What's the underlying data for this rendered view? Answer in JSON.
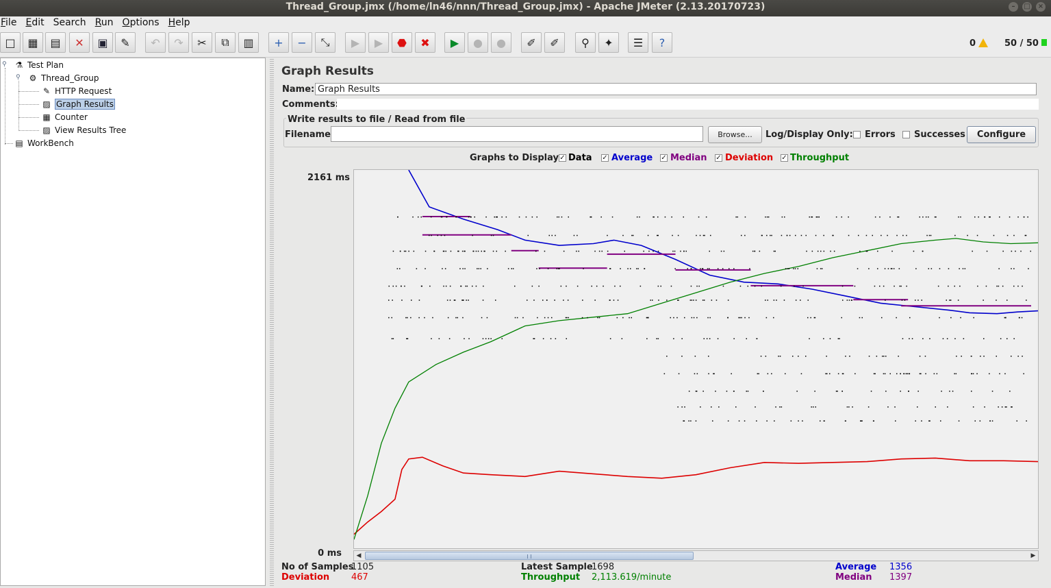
{
  "window": {
    "title": "Thread_Group.jmx (/home/ln46/nnn/Thread_Group.jmx) - Apache JMeter (2.13.20170723)"
  },
  "menu": [
    {
      "underline": "F",
      "rest": "ile"
    },
    {
      "underline": "E",
      "rest": "dit"
    },
    {
      "underline": "",
      "rest": "Search"
    },
    {
      "underline": "R",
      "rest": "un"
    },
    {
      "underline": "O",
      "rest": "ptions"
    },
    {
      "underline": "H",
      "rest": "elp"
    }
  ],
  "toolbar": {
    "buttons": [
      {
        "name": "new-icon",
        "glyph": "□",
        "disabled": false
      },
      {
        "name": "templates-icon",
        "glyph": "▦",
        "disabled": false
      },
      {
        "name": "open-icon",
        "glyph": "▤",
        "disabled": false
      },
      {
        "name": "close-icon",
        "glyph": "✕",
        "disabled": false
      },
      {
        "name": "save-icon",
        "glyph": "▣",
        "disabled": false
      },
      {
        "name": "save-as-icon",
        "glyph": "✎",
        "disabled": false
      },
      {
        "name": "undo-icon",
        "glyph": "↶",
        "disabled": true
      },
      {
        "name": "redo-icon",
        "glyph": "↷",
        "disabled": true
      },
      {
        "name": "cut-icon",
        "glyph": "✂",
        "disabled": false
      },
      {
        "name": "copy-icon",
        "glyph": "⧉",
        "disabled": false
      },
      {
        "name": "paste-icon",
        "glyph": "▥",
        "disabled": false
      },
      {
        "name": "expand-icon",
        "glyph": "+",
        "disabled": false
      },
      {
        "name": "collapse-icon",
        "glyph": "−",
        "disabled": false
      },
      {
        "name": "toggle-icon",
        "glyph": "⤡",
        "disabled": false
      },
      {
        "name": "start-icon",
        "glyph": "▶",
        "disabled": true
      },
      {
        "name": "start-no-pause-icon",
        "glyph": "▶",
        "disabled": true
      },
      {
        "name": "stop-icon",
        "glyph": "⬣",
        "disabled": false
      },
      {
        "name": "shutdown-icon",
        "glyph": "✖",
        "disabled": false
      },
      {
        "name": "remote-start-icon",
        "glyph": "▶",
        "disabled": false
      },
      {
        "name": "remote-stop-icon",
        "glyph": "●",
        "disabled": true
      },
      {
        "name": "remote-exit-icon",
        "glyph": "●",
        "disabled": true
      },
      {
        "name": "clear-icon",
        "glyph": "✐",
        "disabled": false
      },
      {
        "name": "clear-all-icon",
        "glyph": "✐",
        "disabled": false
      },
      {
        "name": "search-icon",
        "glyph": "⚲",
        "disabled": false
      },
      {
        "name": "reset-search-icon",
        "glyph": "✦",
        "disabled": false
      },
      {
        "name": "function-helper-icon",
        "glyph": "☰",
        "disabled": false
      },
      {
        "name": "help-icon",
        "glyph": "?",
        "disabled": false
      }
    ],
    "error_count": "0",
    "threads": "50 / 50"
  },
  "tree": {
    "items": [
      {
        "label": "Test Plan",
        "icon": "test-plan-icon",
        "glyph": "⚗"
      },
      {
        "label": "Thread_Group",
        "icon": "thread-group-icon",
        "glyph": "⚙"
      },
      {
        "label": "HTTP Request",
        "icon": "http-request-icon",
        "glyph": "✎"
      },
      {
        "label": "Graph Results",
        "icon": "graph-results-icon",
        "glyph": "▨"
      },
      {
        "label": "Counter",
        "icon": "counter-icon",
        "glyph": "▦"
      },
      {
        "label": "View Results Tree",
        "icon": "view-results-tree-icon",
        "glyph": "▨"
      },
      {
        "label": "WorkBench",
        "icon": "workbench-icon",
        "glyph": "▤"
      }
    ]
  },
  "panel": {
    "title": "Graph Results",
    "name_label": "Name:",
    "name_value": "Graph Results",
    "comments_label": "Comments:",
    "file_section_title": "Write results to file / Read from file",
    "filename_label": "Filename",
    "filename_value": "",
    "browse_label": "Browse...",
    "log_display_label": "Log/Display Only:",
    "errors_label": "Errors",
    "successes_label": "Successes",
    "configure_label": "Configure",
    "graphs_to_display_label": "Graphs to Display",
    "toggles": [
      {
        "label": "Data",
        "color": "#000000",
        "checked": true
      },
      {
        "label": "Average",
        "color": "#0000cc",
        "checked": true
      },
      {
        "label": "Median",
        "color": "#800080",
        "checked": true
      },
      {
        "label": "Deviation",
        "color": "#dd0000",
        "checked": true
      },
      {
        "label": "Throughput",
        "color": "#008000",
        "checked": true
      }
    ],
    "y_max_label": "2161  ms",
    "y_min_label": "0  ms"
  },
  "chart_data": {
    "type": "line",
    "y_unit": "ms",
    "ylim": [
      0,
      2161
    ],
    "series": [
      {
        "name": "Average",
        "color": "#0000cc",
        "samples": [
          [
            0.08,
            2161
          ],
          [
            0.11,
            1950
          ],
          [
            0.16,
            1880
          ],
          [
            0.21,
            1820
          ],
          [
            0.25,
            1760
          ],
          [
            0.3,
            1730
          ],
          [
            0.35,
            1740
          ],
          [
            0.38,
            1760
          ],
          [
            0.42,
            1730
          ],
          [
            0.47,
            1650
          ],
          [
            0.52,
            1560
          ],
          [
            0.57,
            1520
          ],
          [
            0.62,
            1510
          ],
          [
            0.67,
            1480
          ],
          [
            0.72,
            1440
          ],
          [
            0.77,
            1400
          ],
          [
            0.82,
            1380
          ],
          [
            0.87,
            1360
          ],
          [
            0.9,
            1345
          ],
          [
            0.94,
            1340
          ],
          [
            0.97,
            1350
          ],
          [
            1.0,
            1356
          ]
        ]
      },
      {
        "name": "Deviation",
        "color": "#dd0000",
        "samples": [
          [
            0.0,
            80
          ],
          [
            0.02,
            150
          ],
          [
            0.04,
            210
          ],
          [
            0.06,
            280
          ],
          [
            0.07,
            450
          ],
          [
            0.08,
            510
          ],
          [
            0.1,
            520
          ],
          [
            0.13,
            470
          ],
          [
            0.16,
            430
          ],
          [
            0.2,
            420
          ],
          [
            0.25,
            410
          ],
          [
            0.3,
            440
          ],
          [
            0.35,
            425
          ],
          [
            0.4,
            410
          ],
          [
            0.45,
            400
          ],
          [
            0.5,
            420
          ],
          [
            0.55,
            460
          ],
          [
            0.6,
            490
          ],
          [
            0.65,
            485
          ],
          [
            0.7,
            490
          ],
          [
            0.75,
            495
          ],
          [
            0.8,
            510
          ],
          [
            0.85,
            515
          ],
          [
            0.9,
            500
          ],
          [
            0.95,
            500
          ],
          [
            1.0,
            495
          ]
        ]
      },
      {
        "name": "Throughput",
        "color": "#008000",
        "samples": [
          [
            0.0,
            50
          ],
          [
            0.02,
            300
          ],
          [
            0.04,
            600
          ],
          [
            0.06,
            800
          ],
          [
            0.08,
            950
          ],
          [
            0.12,
            1050
          ],
          [
            0.16,
            1120
          ],
          [
            0.2,
            1180
          ],
          [
            0.25,
            1270
          ],
          [
            0.3,
            1300
          ],
          [
            0.35,
            1320
          ],
          [
            0.4,
            1340
          ],
          [
            0.45,
            1400
          ],
          [
            0.5,
            1460
          ],
          [
            0.55,
            1520
          ],
          [
            0.6,
            1570
          ],
          [
            0.65,
            1610
          ],
          [
            0.7,
            1660
          ],
          [
            0.75,
            1700
          ],
          [
            0.8,
            1740
          ],
          [
            0.85,
            1760
          ],
          [
            0.88,
            1770
          ],
          [
            0.92,
            1750
          ],
          [
            0.96,
            1740
          ],
          [
            1.0,
            1745
          ]
        ]
      },
      {
        "name": "Median",
        "color": "#800080",
        "segments": [
          [
            0.1,
            0.17,
            1895
          ],
          [
            0.1,
            0.23,
            1790
          ],
          [
            0.23,
            0.27,
            1700
          ],
          [
            0.27,
            0.37,
            1600
          ],
          [
            0.37,
            0.47,
            1680
          ],
          [
            0.47,
            0.58,
            1590
          ],
          [
            0.58,
            0.73,
            1500
          ],
          [
            0.73,
            0.81,
            1420
          ],
          [
            0.8,
            0.99,
            1385
          ]
        ]
      }
    ]
  },
  "stats": {
    "samples_label": "No of Samples",
    "samples_value": "1105",
    "latest_label": "Latest Sample",
    "latest_value": "1698",
    "average_label": "Average",
    "average_value": "1356",
    "deviation_label": "Deviation",
    "deviation_value": "467",
    "throughput_label": "Throughput",
    "throughput_value": "2,113.619/minute",
    "median_label": "Median",
    "median_value": "1397"
  }
}
